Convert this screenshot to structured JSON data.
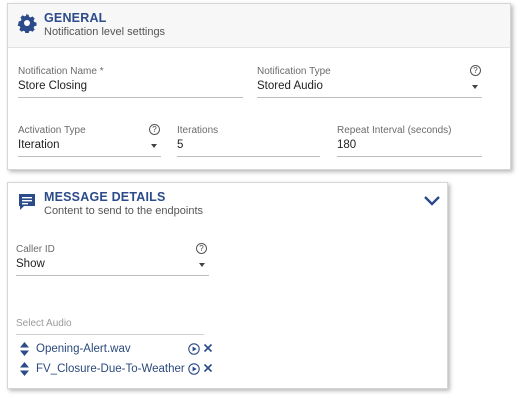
{
  "general": {
    "title": "GENERAL",
    "subtitle": "Notification level settings",
    "icon": "gear-icon",
    "notification_name": {
      "label": "Notification Name *",
      "value": "Store Closing"
    },
    "notification_type": {
      "label": "Notification Type",
      "value": "Stored Audio"
    },
    "activation_type": {
      "label": "Activation Type",
      "value": "Iteration"
    },
    "iterations": {
      "label": "Iterations",
      "value": "5"
    },
    "repeat_interval": {
      "label": "Repeat Interval (seconds)",
      "value": "180"
    },
    "help_glyph": "?"
  },
  "message": {
    "title": "MESSAGE DETAILS",
    "subtitle": "Content to send to the endpoints",
    "icon": "message-icon",
    "caller_id": {
      "label": "Caller ID",
      "value": "Show"
    },
    "select_audio": {
      "placeholder": "Select Audio"
    },
    "audio_files": [
      {
        "name": "Opening-Alert.wav"
      },
      {
        "name": "FV_Closure-Due-To-Weather"
      }
    ],
    "help_glyph": "?"
  },
  "colors": {
    "accent": "#2c4b8a",
    "text": "#333333",
    "line": "#bdbdbd"
  }
}
